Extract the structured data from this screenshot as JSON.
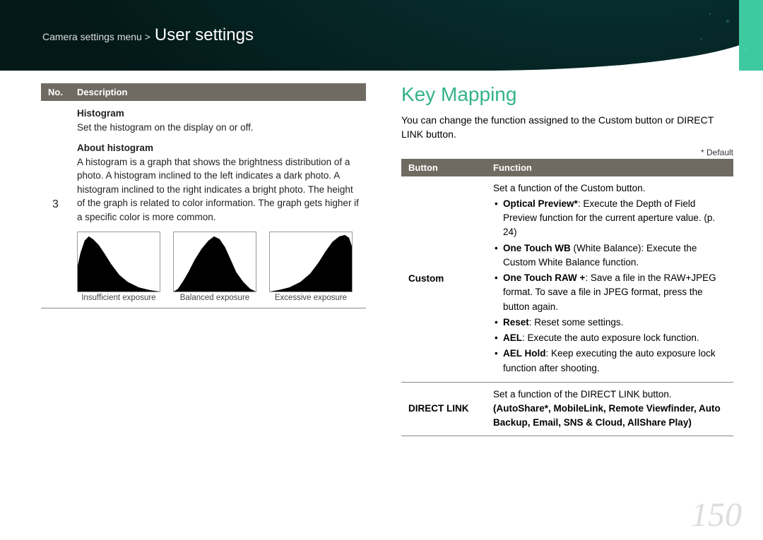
{
  "breadcrumb": {
    "path": "Camera settings menu >",
    "title": "User settings"
  },
  "left": {
    "headers": {
      "no": "No.",
      "desc": "Description"
    },
    "row_num": "3",
    "histogram_title": "Histogram",
    "histogram_text": "Set the histogram on the display on or off.",
    "about_title": "About histogram",
    "about_text": "A histogram is a graph that shows the brightness distribution of a photo. A histogram inclined to the left indicates a dark photo. A histogram inclined to the right indicates a bright photo. The height of the graph is related to color information. The graph gets higher if a specific color is more common.",
    "captions": [
      "Insufficient exposure",
      "Balanced exposure",
      "Excessive exposure"
    ]
  },
  "right": {
    "heading": "Key Mapping",
    "intro": "You can change the function assigned to the Custom button or DIRECT LINK button.",
    "default_note": "* Default",
    "headers": {
      "button": "Button",
      "function": "Function"
    },
    "rows": [
      {
        "button": "Custom",
        "lead": "Set a function of the Custom button.",
        "items": [
          {
            "b": "Optical Preview*",
            "t": ": Execute the Depth of Field Preview function for the current aperture value. (p. 24)"
          },
          {
            "b": "One Touch WB",
            "t": " (White Balance): Execute the Custom White Balance function."
          },
          {
            "b": "One Touch RAW +",
            "t": ": Save a file in the RAW+JPEG format. To save a file in JPEG format, press the button again."
          },
          {
            "b": "Reset",
            "t": ": Reset some settings."
          },
          {
            "b": "AEL",
            "t": ": Execute the auto exposure lock function."
          },
          {
            "b": "AEL Hold",
            "t": ": Keep executing the auto exposure lock function after shooting."
          }
        ]
      },
      {
        "button": "DIRECT LINK",
        "lead": "Set a function of the DIRECT LINK button.",
        "bold_line": "(AutoShare*, MobileLink, Remote Viewfinder, Auto Backup, Email, SNS & Cloud, AllShare Play)"
      }
    ]
  },
  "page_number": "150"
}
